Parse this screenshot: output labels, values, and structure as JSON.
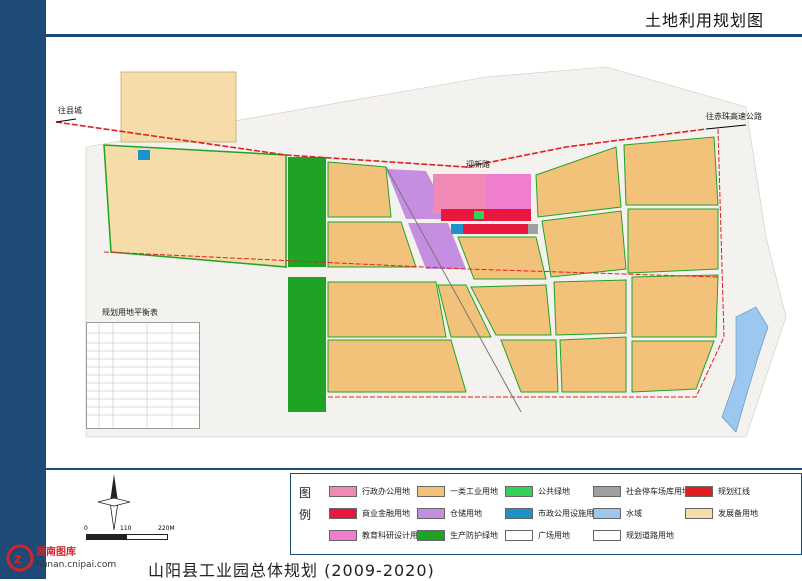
{
  "header": {
    "title": "土地利用规划图"
  },
  "footer": {
    "title": "山阳县工业园总体规划 (2009-2020)"
  },
  "watermark": {
    "name": "湖南图库",
    "url": "hunan.cnipai.com"
  },
  "map": {
    "road_labels": {
      "left": "往县城",
      "right": "往赤珠高速公路",
      "main": "迎新路"
    },
    "table_title": "规划用地平衡表",
    "scale": {
      "start": "0",
      "mid": "110",
      "end": "220M"
    }
  },
  "legend": {
    "heading": "图例",
    "items": [
      {
        "label": "行政办公用地",
        "color": "#f08ab4"
      },
      {
        "label": "一类工业用地",
        "color": "#f3c27a"
      },
      {
        "label": "公共绿地",
        "color": "#34d15a"
      },
      {
        "label": "社会停车场库用地",
        "color": "#a0a0a0"
      },
      {
        "label": "规划红线",
        "color": "#e02020"
      },
      {
        "label": "商业金融用地",
        "color": "#e8173e"
      },
      {
        "label": "仓储用地",
        "color": "#c58ee0"
      },
      {
        "label": "市政公用设施用地",
        "color": "#1b93c9"
      },
      {
        "label": "水域",
        "color": "#9cc7ee"
      },
      {
        "label": "发展备用地",
        "color": "#f5dca8"
      },
      {
        "label": "教育科研设计用地",
        "color": "#f07ed0"
      },
      {
        "label": "生产防护绿地",
        "color": "#1fa325"
      },
      {
        "label": "广场用地",
        "color": "#ffffff"
      },
      {
        "label": "规划道路用地",
        "color": "#ffffff"
      }
    ]
  },
  "colors": {
    "accent": "#1e4a78",
    "industrial": "#f3c27a",
    "reserve": "#f5dca8",
    "green": "#1fa325",
    "storage": "#c58ee0",
    "admin": "#f08ab4",
    "commercial": "#e8173e",
    "water": "#9cc7ee"
  }
}
